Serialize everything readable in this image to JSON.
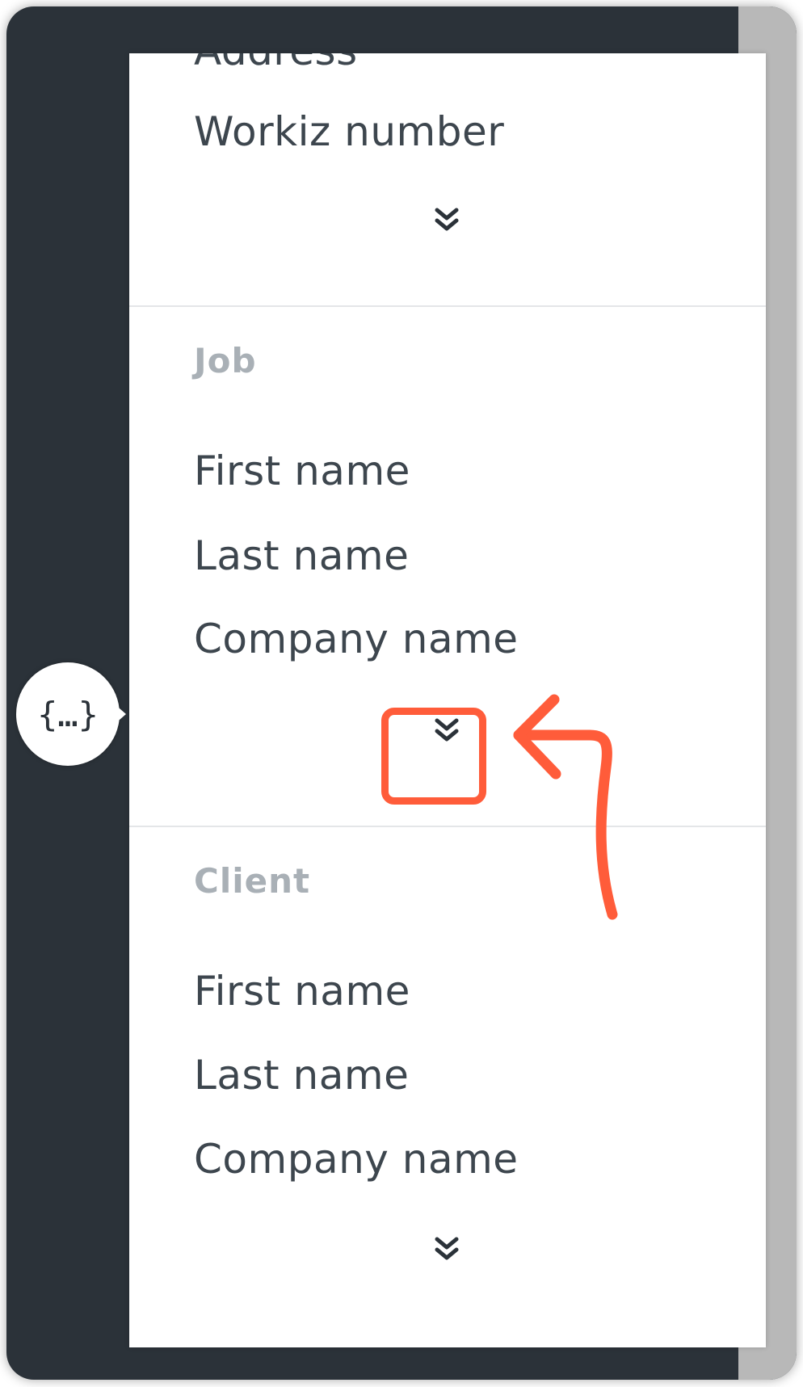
{
  "top_section": {
    "cut_off_item": "Address",
    "items": [
      "Workiz number"
    ],
    "expand_icon": "double-chevron-down-icon"
  },
  "job_section": {
    "heading": "Job",
    "items": [
      "First name",
      "Last name",
      "Company name"
    ],
    "expand_icon": "double-chevron-down-icon"
  },
  "client_section": {
    "heading": "Client",
    "items": [
      "First name",
      "Last name",
      "Company name"
    ],
    "expand_icon": "double-chevron-down-icon"
  },
  "variable_bubble": {
    "label": "{…}",
    "icon": "variables-braces-icon"
  },
  "colors": {
    "dark_background": "#2b3239",
    "panel": "#ffffff",
    "item_text": "#3d464e",
    "heading_text": "#a9b0b6",
    "annotation": "#ff5c3a",
    "right_strip": "#b8b8b8"
  }
}
